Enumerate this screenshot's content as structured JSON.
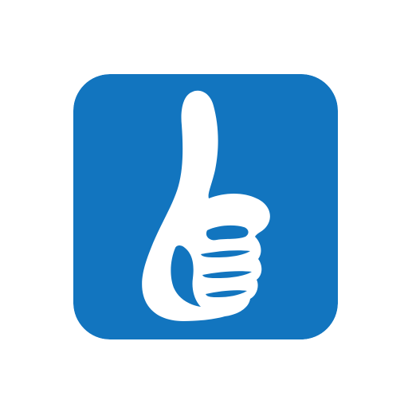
{
  "icon": {
    "name": "thumbs-up-icon",
    "background_color": "#1275BF",
    "glyph_color": "#ffffff"
  }
}
